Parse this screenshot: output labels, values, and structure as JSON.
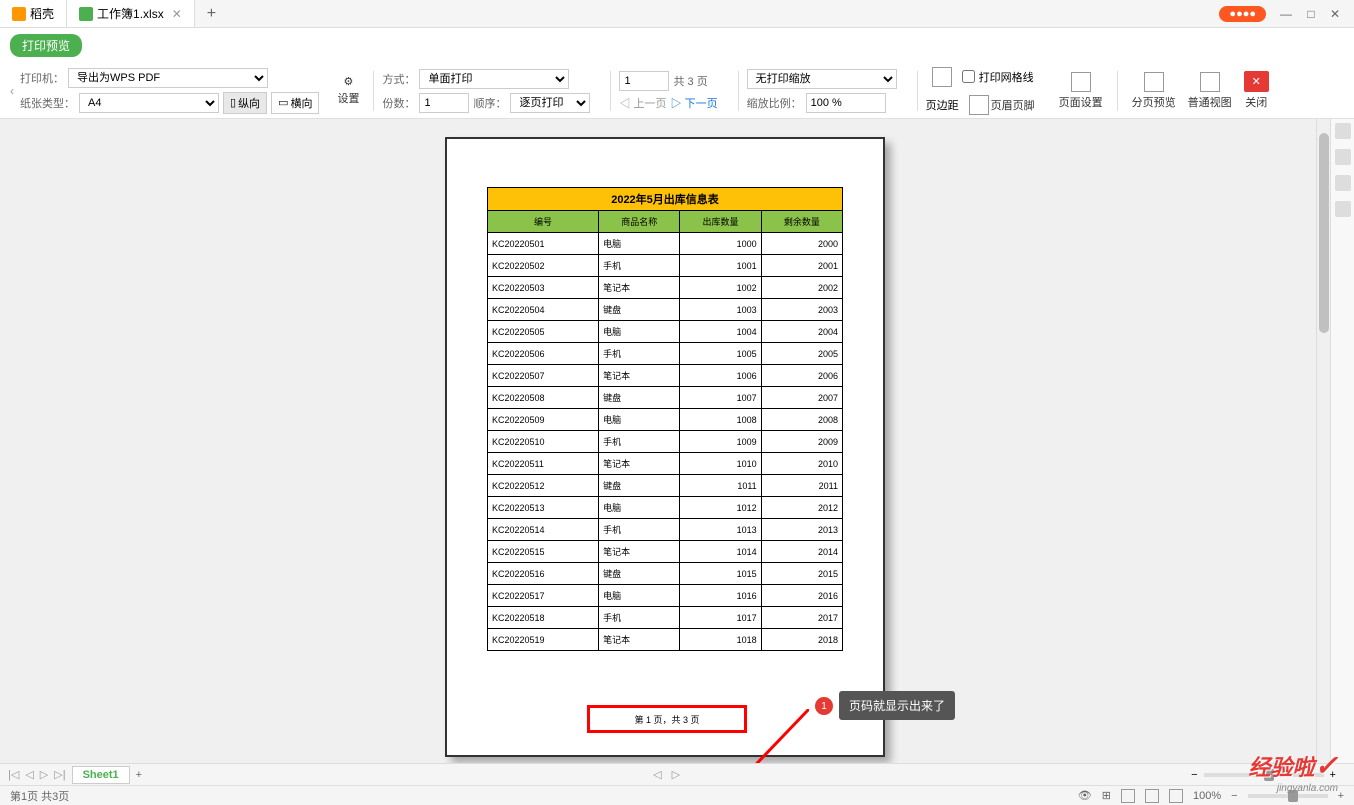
{
  "tabs": [
    {
      "label": "稻壳"
    },
    {
      "label": "工作簿1.xlsx"
    }
  ],
  "preview_badge": "打印预览",
  "toolbar": {
    "printer_label": "打印机：",
    "printer_value": "导出为WPS PDF",
    "paper_label": "纸张类型：",
    "paper_value": "A4",
    "settings": "设置",
    "method_label": "方式：",
    "method_value": "单面打印",
    "copies_label": "份数：",
    "copies_value": "1",
    "order_label": "顺序：",
    "order_value": "逐页打印",
    "portrait": "纵向",
    "landscape": "横向",
    "page_input": "1",
    "page_total": "共 3 页",
    "prev_page": "上一页",
    "next_page": "下一页",
    "scale_label": "无打印缩放",
    "ratio_label": "缩放比例：",
    "ratio_value": "100 %",
    "margins": "页边距",
    "gridlines": "打印网格线",
    "header_footer": "页眉页脚",
    "page_setup": "页面设置",
    "page_break": "分页预览",
    "normal_view": "普通视图",
    "close": "关闭"
  },
  "table": {
    "title": "2022年5月出库信息表",
    "headers": [
      "编号",
      "商品名称",
      "出库数量",
      "剩余数量"
    ],
    "rows": [
      [
        "KC20220501",
        "电脑",
        "1000",
        "2000"
      ],
      [
        "KC20220502",
        "手机",
        "1001",
        "2001"
      ],
      [
        "KC20220503",
        "笔记本",
        "1002",
        "2002"
      ],
      [
        "KC20220504",
        "键盘",
        "1003",
        "2003"
      ],
      [
        "KC20220505",
        "电脑",
        "1004",
        "2004"
      ],
      [
        "KC20220506",
        "手机",
        "1005",
        "2005"
      ],
      [
        "KC20220507",
        "笔记本",
        "1006",
        "2006"
      ],
      [
        "KC20220508",
        "键盘",
        "1007",
        "2007"
      ],
      [
        "KC20220509",
        "电脑",
        "1008",
        "2008"
      ],
      [
        "KC20220510",
        "手机",
        "1009",
        "2009"
      ],
      [
        "KC20220511",
        "笔记本",
        "1010",
        "2010"
      ],
      [
        "KC20220512",
        "键盘",
        "1011",
        "2011"
      ],
      [
        "KC20220513",
        "电脑",
        "1012",
        "2012"
      ],
      [
        "KC20220514",
        "手机",
        "1013",
        "2013"
      ],
      [
        "KC20220515",
        "笔记本",
        "1014",
        "2014"
      ],
      [
        "KC20220516",
        "键盘",
        "1015",
        "2015"
      ],
      [
        "KC20220517",
        "电脑",
        "1016",
        "2016"
      ],
      [
        "KC20220518",
        "手机",
        "1017",
        "2017"
      ],
      [
        "KC20220519",
        "笔记本",
        "1018",
        "2018"
      ]
    ]
  },
  "footer_text": "第 1 页，共 3 页",
  "annotation": {
    "number": "1",
    "text": "页码就显示出来了"
  },
  "sheet": {
    "name": "Sheet1"
  },
  "status": {
    "page_info": "第1页 共3页",
    "zoom": "100%"
  },
  "watermark": {
    "main": "经验啦",
    "sub": "jingyanla.com"
  }
}
